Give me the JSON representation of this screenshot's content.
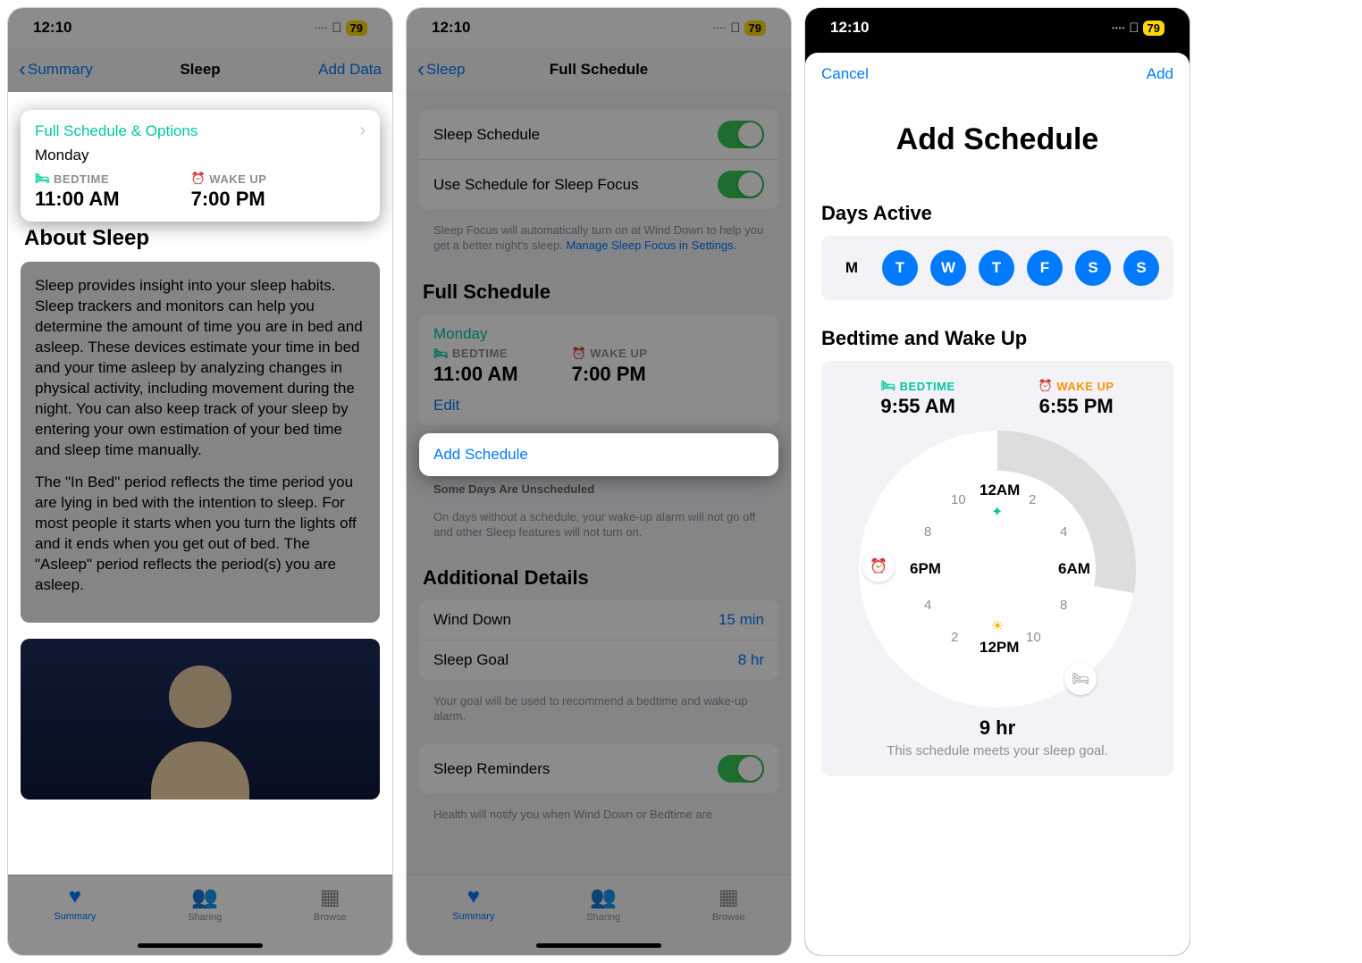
{
  "status": {
    "time": "12:10",
    "battery": "79"
  },
  "p1": {
    "back": "Summary",
    "title": "Sleep",
    "action": "Add Data",
    "card_link": "Full Schedule & Options",
    "day": "Monday",
    "bed_label": "BEDTIME",
    "wake_label": "WAKE UP",
    "bed_time": "11:00 AM",
    "wake_time": "7:00 PM",
    "about_h": "About Sleep",
    "about_p1": "Sleep provides insight into your sleep habits. Sleep trackers and monitors can help you determine the amount of time you are in bed and asleep. These devices estimate your time in bed and your time asleep by analyzing changes in physical activity, including movement during the night. You can also keep track of your sleep by entering your own estimation of your bed time and sleep time manually.",
    "about_p2": "The \"In Bed\" period reflects the time period you are lying in bed with the intention to sleep. For most people it starts when you turn the lights off and it ends when you get out of bed. The \"Asleep\" period reflects the period(s) you are asleep.",
    "tabs": {
      "summary": "Summary",
      "sharing": "Sharing",
      "browse": "Browse"
    }
  },
  "p2": {
    "back": "Sleep",
    "title": "Full Schedule",
    "rows": {
      "sleep_schedule": "Sleep Schedule",
      "use_focus": "Use Schedule for Sleep Focus"
    },
    "focus_footer": "Sleep Focus will automatically turn on at Wind Down to help you get a better night's sleep. ",
    "focus_link": "Manage Sleep Focus in Settings.",
    "full_h": "Full Schedule",
    "day": "Monday",
    "bed_label": "BEDTIME",
    "wake_label": "WAKE UP",
    "bed_time": "11:00 AM",
    "wake_time": "7:00 PM",
    "edit": "Edit",
    "add_schedule": "Add Schedule",
    "unsched_h": "Some Days Are Unscheduled",
    "unsched_body": "On days without a schedule, your wake-up alarm will not go off and other Sleep features will not turn on.",
    "details_h": "Additional Details",
    "wind_down": "Wind Down",
    "wind_down_val": "15 min",
    "sleep_goal": "Sleep Goal",
    "sleep_goal_val": "8 hr",
    "goal_footer": "Your goal will be used to recommend a bedtime and wake-up alarm.",
    "reminders": "Sleep Reminders",
    "reminders_footer": "Health will notify you when Wind Down or Bedtime are"
  },
  "p3": {
    "cancel": "Cancel",
    "add": "Add",
    "title": "Add Schedule",
    "days_h": "Days Active",
    "days": [
      "M",
      "T",
      "W",
      "T",
      "F",
      "S",
      "S"
    ],
    "bedwake_h": "Bedtime and Wake Up",
    "bed_label": "BEDTIME",
    "wake_label": "WAKE UP",
    "bed_time": "9:55 AM",
    "wake_time": "6:55 PM",
    "dial_labels": {
      "top": "12AM",
      "bottom": "12PM",
      "left": "6PM",
      "right": "6AM",
      "n2r": "2",
      "n4r": "4",
      "n8r": "8",
      "n10r": "10",
      "n2l": "2",
      "n4l": "4",
      "n8l": "8",
      "n10l": "10"
    },
    "goal": "9 hr",
    "goal_sub": "This schedule meets your sleep goal."
  }
}
